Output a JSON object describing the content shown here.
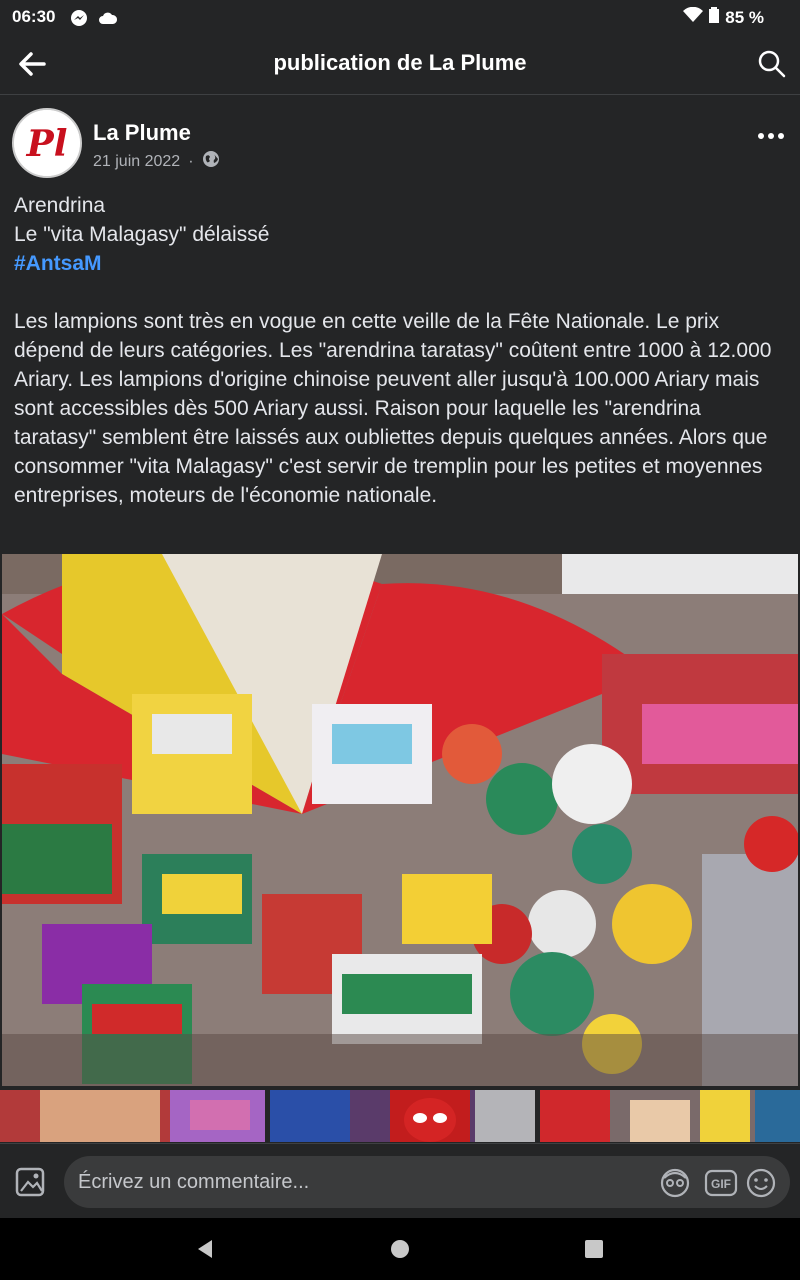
{
  "status": {
    "time": "06:30",
    "battery": "85 %",
    "icons": [
      "messenger-icon",
      "cloud-icon",
      "wifi-icon",
      "battery-icon"
    ]
  },
  "appbar": {
    "title": "publication de La Plume",
    "back_icon": "arrow-left-icon",
    "search_icon": "search-icon"
  },
  "post": {
    "author": "La Plume",
    "avatar_text": "Pl",
    "date": "21 juin 2022",
    "separator": "·",
    "privacy_icon": "globe-icon",
    "more_icon": "more-horizontal-icon",
    "title_line1": "Arendrina",
    "title_line2": "Le \"vita Malagasy\" délaissé",
    "hashtag": "#AntsaM",
    "body": "Les lampions sont très en vogue en cette veille de la Fête Nationale. Le prix dépend de leurs catégories. Les \"arendrina taratasy\" coûtent entre 1000 à 12.000 Ariary. Les lampions d'origine chinoise peuvent  aller jusqu'à 100.000 Ariary mais sont accessibles dès 500 Ariary aussi. Raison pour laquelle les \"arendrina taratasy\" semblent être laissés  aux oubliettes depuis quelques années. Alors que consommer \"vita Malagasy\" c'est servir de  tremplin pour les  petites et moyennes entreprises, moteurs de l'économie nationale.",
    "main_image": "paper-lanterns-market-photo",
    "thumbnails": [
      "lantern-hand-photo",
      "spiderman-mask-photo",
      "lantern-vendor-photo"
    ]
  },
  "comment": {
    "placeholder": "Écrivez un commentaire...",
    "image_icon": "image-icon",
    "avatar_icon": "avatar-sticker-icon",
    "gif_label": "GIF",
    "emoji_icon": "emoji-icon"
  },
  "navbar": {
    "icons": [
      "back-triangle-icon",
      "home-circle-icon",
      "recents-square-icon"
    ]
  },
  "colors": {
    "background": "#242526",
    "text": "#e4e6eb",
    "secondary_text": "#b0b3b8",
    "hashtag": "#4599ff",
    "input_bg": "#3a3b3c"
  }
}
